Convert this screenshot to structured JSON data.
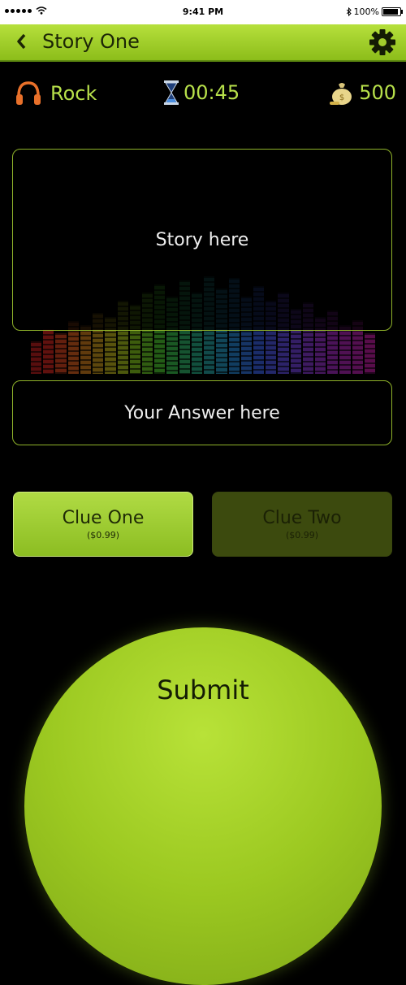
{
  "status_bar": {
    "time": "9:41 PM",
    "battery": "100%"
  },
  "nav": {
    "title": "Story One"
  },
  "info": {
    "genre": "Rock",
    "timer": "00:45",
    "coins": "500"
  },
  "story": {
    "text": "Story here"
  },
  "answer": {
    "placeholder": "Your Answer here"
  },
  "clues": [
    {
      "title": "Clue One",
      "price": "($0.99)"
    },
    {
      "title": "Clue Two",
      "price": "($0.99)"
    }
  ],
  "submit": {
    "label": "Submit"
  },
  "colors": {
    "accent": "#a6d233",
    "accent_dark": "#3c4a0e",
    "background": "#000000",
    "headphone": "#e8702a"
  },
  "icons": [
    "back-chevron-icon",
    "gear-icon",
    "headphones-icon",
    "hourglass-icon",
    "money-bag-icon",
    "wifi-icon",
    "bluetooth-icon",
    "battery-icon"
  ]
}
